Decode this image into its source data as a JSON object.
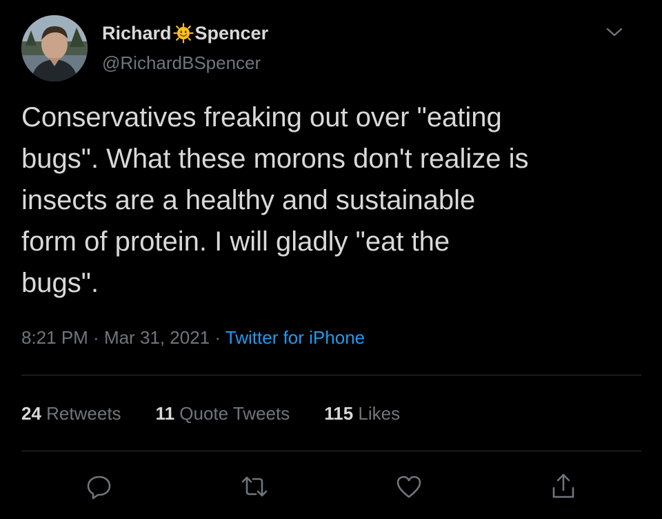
{
  "author": {
    "name_part1": "Richard",
    "name_emoji": "sun-with-face-emoji",
    "name_part2": "Spencer",
    "handle": "@RichardBSpencer"
  },
  "tweet": {
    "text": "Conservatives freaking out over \"eating\nbugs\". What these morons don't realize is\ninsects are a healthy and sustainable\nform of protein. I will gladly \"eat the\nbugs\"."
  },
  "meta": {
    "time": "8:21 PM",
    "sep1": " · ",
    "date": "Mar 31, 2021",
    "sep2": " · ",
    "source": "Twitter for iPhone"
  },
  "stats": {
    "retweets_count": "24",
    "retweets_label": "Retweets",
    "quotes_count": "11",
    "quotes_label": "Quote Tweets",
    "likes_count": "115",
    "likes_label": "Likes"
  },
  "actions": [
    {
      "icon": "reply-icon"
    },
    {
      "icon": "retweet-icon"
    },
    {
      "icon": "like-icon"
    },
    {
      "icon": "share-icon"
    }
  ],
  "colors": {
    "background": "#000000",
    "text": "#d9d9d9",
    "secondary": "#6e767d",
    "link": "#1d9bf0",
    "divider": "#2f3336"
  }
}
